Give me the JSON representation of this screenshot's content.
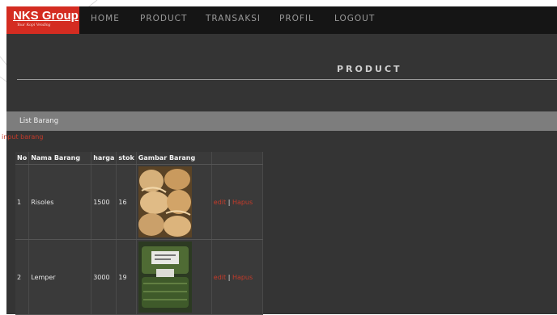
{
  "brand": {
    "title": "NKS Group",
    "subtitle": "Your Kopi Vending"
  },
  "nav": [
    {
      "label": "HOME"
    },
    {
      "label": "PRODUCT"
    },
    {
      "label": "TRANSAKSI"
    },
    {
      "label": "PROFIL"
    },
    {
      "label": "LOGOUT"
    }
  ],
  "page": {
    "title": "PRODUCT"
  },
  "section": {
    "title": "List Barang",
    "input_link": "input barang"
  },
  "table": {
    "headers": {
      "no": "No",
      "name": "Nama Barang",
      "price": "harga",
      "stock": "stok",
      "image": "Gambar Barang",
      "action": ""
    },
    "rows": [
      {
        "no": "1",
        "name": "Risoles",
        "price": "1500",
        "stock": "16",
        "image": "risoles-photo",
        "edit": "edit",
        "sep": "|",
        "delete": "Hapus"
      },
      {
        "no": "2",
        "name": "Lemper",
        "price": "3000",
        "stock": "19",
        "image": "lemper-photo",
        "edit": "edit",
        "sep": "|",
        "delete": "Hapus"
      }
    ]
  },
  "colors": {
    "brand_red": "#d42c21",
    "link_red": "#c43a2a",
    "bg": "#343434",
    "topbar": "#151515"
  }
}
